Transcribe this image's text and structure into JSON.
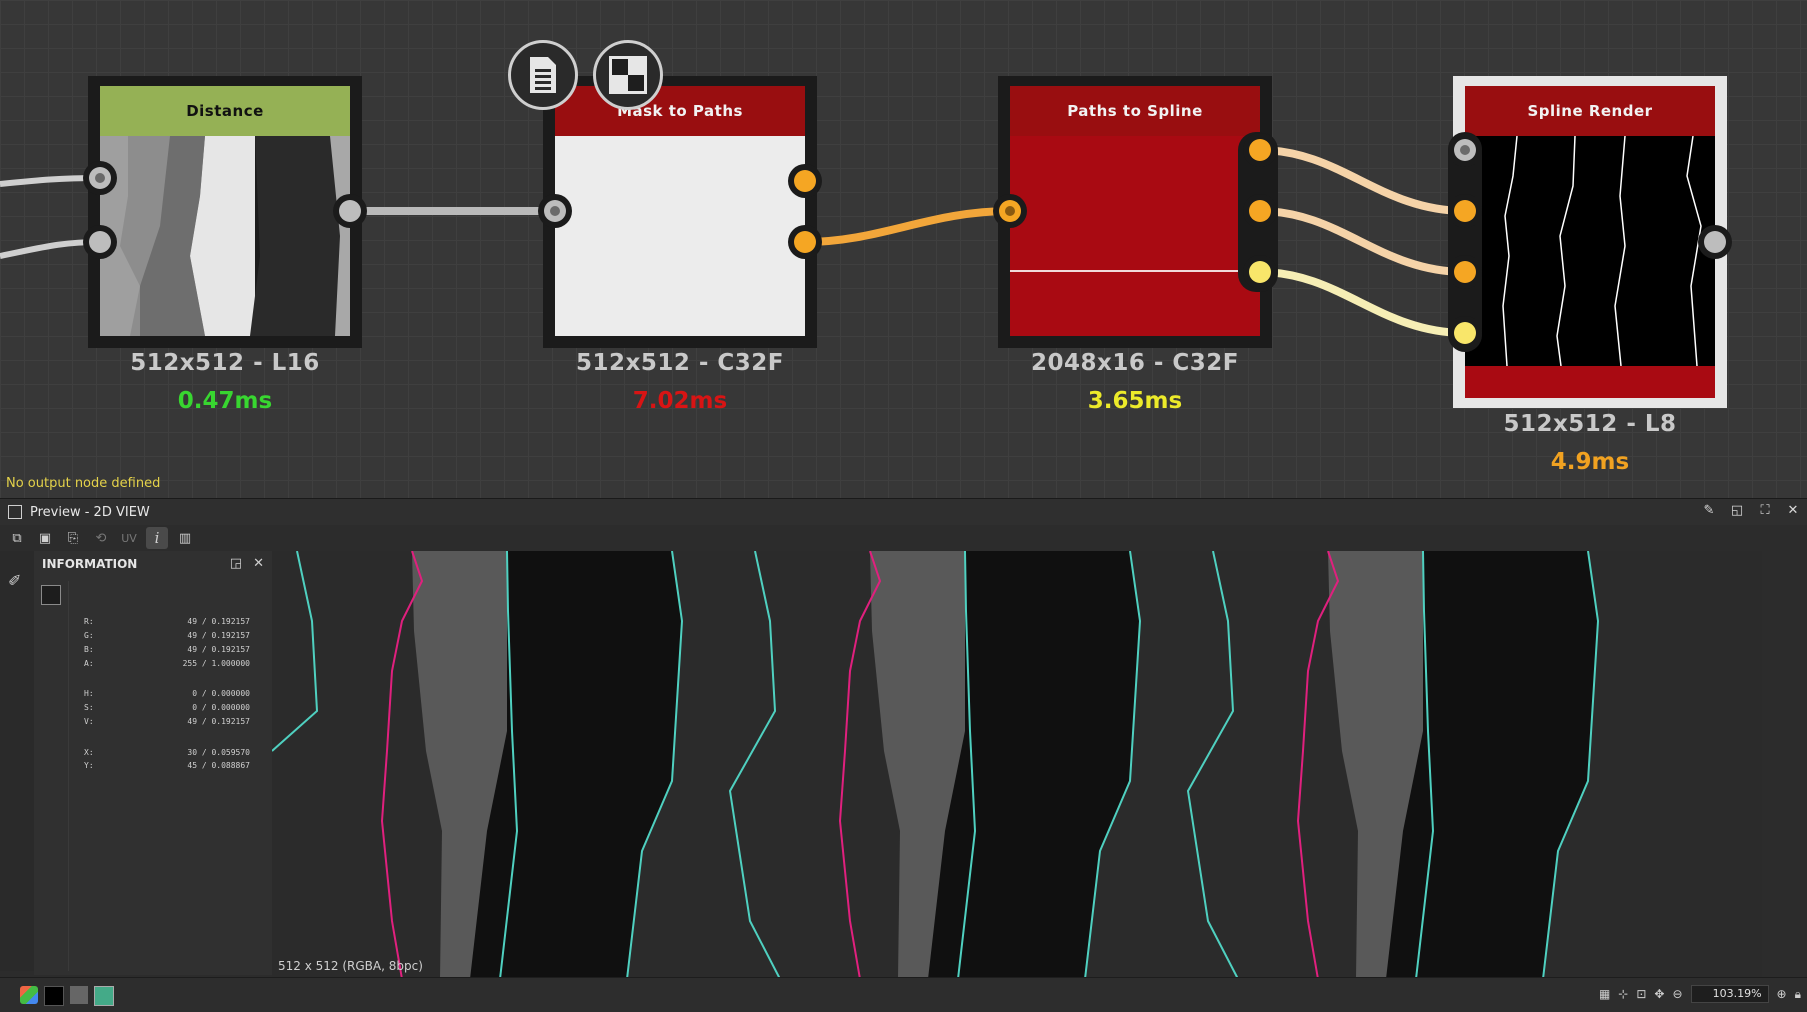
{
  "graph": {
    "status_message": "No output node defined",
    "nodes": [
      {
        "title": "Distance",
        "resolution": "512x512 - L16",
        "time": "0.47ms",
        "time_color": "#38d630",
        "header_color": "#95b155"
      },
      {
        "title": "Mask to Paths",
        "resolution": "512x512 - C32F",
        "time": "7.02ms",
        "time_color": "#d81414",
        "header_color": "#990e10"
      },
      {
        "title": "Paths to Spline",
        "resolution": "2048x16 - C32F",
        "time": "3.65ms",
        "time_color": "#ecea2a",
        "header_color": "#990e10"
      },
      {
        "title": "Spline Render",
        "resolution": "512x512 - L8",
        "time": "4.9ms",
        "time_color": "#f1a221",
        "header_color": "#990e10"
      }
    ],
    "floating_buttons": [
      {
        "icon": "document-icon"
      },
      {
        "icon": "checker-icon"
      }
    ]
  },
  "preview": {
    "title": "Preview - 2D VIEW",
    "toolbar": {
      "uv_label": "UV",
      "info_label": "i"
    },
    "info_panel": {
      "title": "INFORMATION",
      "rgba": [
        {
          "label": "R:",
          "value": "49 / 0.192157"
        },
        {
          "label": "G:",
          "value": "49 / 0.192157"
        },
        {
          "label": "B:",
          "value": "49 / 0.192157"
        },
        {
          "label": "A:",
          "value": "255 / 1.000000"
        }
      ],
      "hsv": [
        {
          "label": "H:",
          "value": "0 / 0.000000"
        },
        {
          "label": "S:",
          "value": "0 / 0.000000"
        },
        {
          "label": "V:",
          "value": "49 / 0.192157"
        }
      ],
      "xy": [
        {
          "label": "X:",
          "value": "30 / 0.059570"
        },
        {
          "label": "Y:",
          "value": "45 / 0.088867"
        }
      ]
    },
    "image_info": "512 x 512 (RGBA, 8bpc)",
    "zoom": "103.19%"
  }
}
